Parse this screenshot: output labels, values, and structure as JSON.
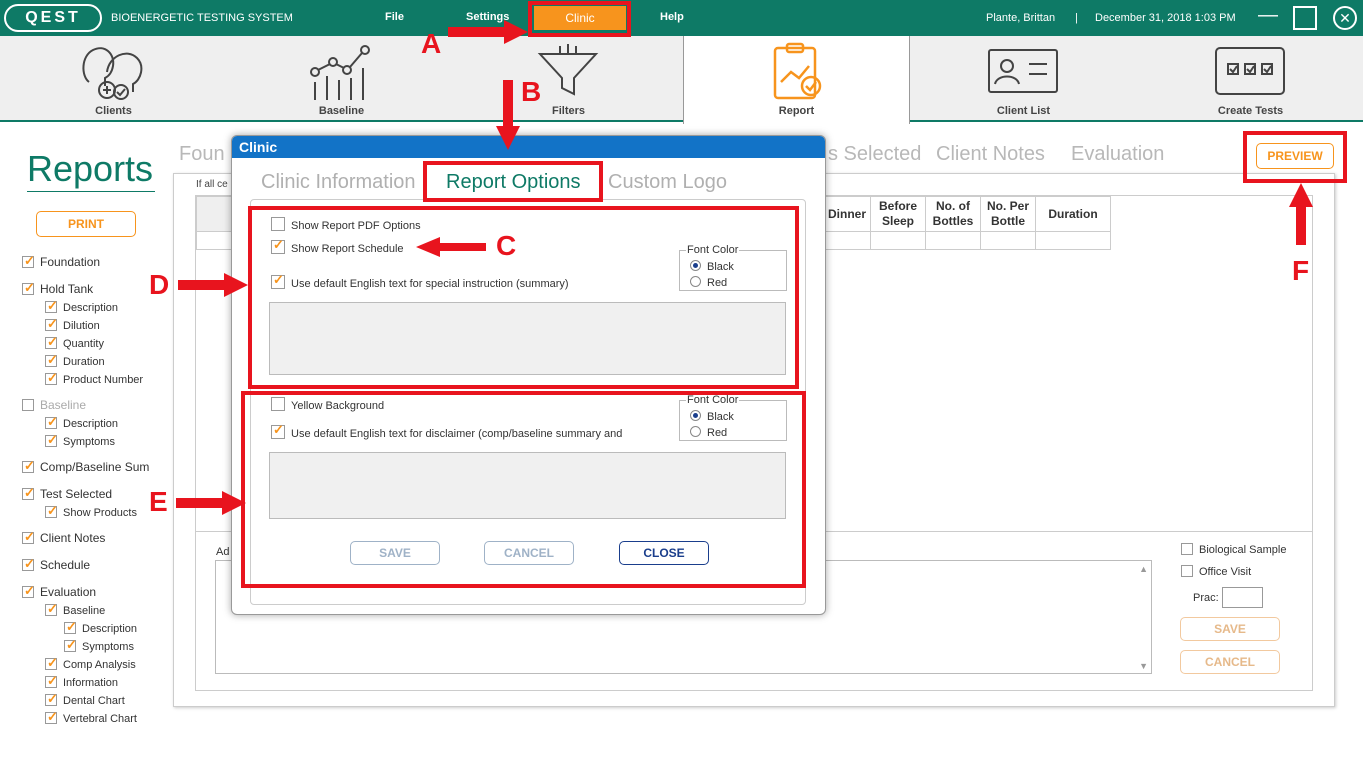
{
  "app": {
    "logo_text": "QEST",
    "title": "BIOENERGETIC TESTING SYSTEM",
    "menu": [
      "File",
      "Settings",
      "Clinic",
      "Help"
    ],
    "user": "Plante, Brittan",
    "separator": "|",
    "datetime": "December 31, 2018  1:03 PM",
    "window_min": "—",
    "window_close": "✕"
  },
  "nav": {
    "tabs": [
      "Clients",
      "Baseline",
      "Filters",
      "Report",
      "Client List",
      "Create Tests"
    ],
    "active": "Report"
  },
  "left_panel": {
    "title": "Reports",
    "print_label": "PRINT",
    "options": [
      {
        "label": "Foundation",
        "checked": true,
        "level": 0
      },
      {
        "label": "Hold Tank",
        "checked": true,
        "level": 0
      },
      {
        "label": "Description",
        "checked": true,
        "level": 1
      },
      {
        "label": "Dilution",
        "checked": true,
        "level": 1
      },
      {
        "label": "Quantity",
        "checked": true,
        "level": 1
      },
      {
        "label": "Duration",
        "checked": true,
        "level": 1
      },
      {
        "label": "Product Number",
        "checked": true,
        "level": 1
      },
      {
        "label": "Baseline",
        "checked": false,
        "level": 0,
        "disabled": true
      },
      {
        "label": "Description",
        "checked": true,
        "level": 1
      },
      {
        "label": "Symptoms",
        "checked": true,
        "level": 1
      },
      {
        "label": "Comp/Baseline Sum",
        "checked": true,
        "level": 0
      },
      {
        "label": "Test Selected",
        "checked": true,
        "level": 0
      },
      {
        "label": "Show Products",
        "checked": true,
        "level": 1
      },
      {
        "label": "Client Notes",
        "checked": true,
        "level": 0
      },
      {
        "label": "Schedule",
        "checked": true,
        "level": 0
      },
      {
        "label": "Evaluation",
        "checked": true,
        "level": 0
      },
      {
        "label": "Baseline",
        "checked": true,
        "level": 1
      },
      {
        "label": "Description",
        "checked": true,
        "level": 2
      },
      {
        "label": "Symptoms",
        "checked": true,
        "level": 2
      },
      {
        "label": "Comp Analysis",
        "checked": true,
        "level": 1
      },
      {
        "label": "Information",
        "checked": true,
        "level": 1
      },
      {
        "label": "Dental Chart",
        "checked": true,
        "level": 1
      },
      {
        "label": "Vertebral Chart",
        "checked": true,
        "level": 1
      }
    ]
  },
  "report_tabs": [
    "Foun",
    "s Selected",
    "Client Notes",
    "Evaluation"
  ],
  "preview_label": "PREVIEW",
  "main": {
    "hint": "If all ce",
    "table_headers": [
      "Dinner",
      "Before Sleep",
      "No. of Bottles",
      "No. Per Bottle",
      "Duration"
    ],
    "notes_label": "Ad",
    "biological_sample": "Biological Sample",
    "office_visit": "Office Visit",
    "prac_label": "Prac:",
    "save_label": "SAVE",
    "cancel_label": "CANCEL"
  },
  "dialog": {
    "title": "Clinic",
    "tabs": [
      "Clinic Information",
      "Report Options",
      "Custom Logo"
    ],
    "active_tab": "Report Options",
    "show_pdf_options": "Show Report PDF Options",
    "show_schedule": "Show Report Schedule",
    "use_default_special": "Use default English text for special instruction (summary)",
    "yellow_background": "Yellow Background",
    "use_default_disclaimer": "Use default English text for disclaimer (comp/baseline summary and",
    "font_color_label": "Font Color",
    "black": "Black",
    "red": "Red",
    "save_label": "SAVE",
    "cancel_label": "CANCEL",
    "close_label": "CLOSE"
  },
  "annotations": {
    "A": "A",
    "B": "B",
    "C": "C",
    "D": "D",
    "E": "E",
    "F": "F",
    "color": "#e8141e"
  },
  "colors": {
    "brand_teal": "#0e7a66",
    "accent_orange": "#f7941d",
    "dialog_blue": "#1273c7"
  }
}
